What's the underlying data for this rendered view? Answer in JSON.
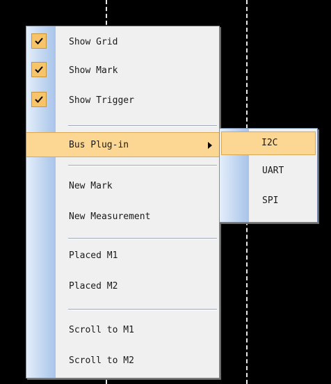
{
  "menu": {
    "items": [
      {
        "label": "Show Grid",
        "checked": true,
        "icon": "check-icon"
      },
      {
        "label": "Show Mark",
        "checked": true,
        "icon": "check-icon"
      },
      {
        "label": "Show Trigger",
        "checked": true,
        "icon": "check-icon"
      },
      {
        "label": "Bus Plug-in",
        "highlighted": true,
        "has_submenu": true,
        "icon": "chevron-right-icon"
      },
      {
        "label": "New Mark"
      },
      {
        "label": "New Measurement"
      },
      {
        "label": "Placed M1"
      },
      {
        "label": "Placed M2"
      },
      {
        "label": "Scroll to M1"
      },
      {
        "label": "Scroll to M2"
      }
    ]
  },
  "submenu": {
    "items": [
      {
        "label": "I2C",
        "highlighted": true
      },
      {
        "label": "UART"
      },
      {
        "label": "SPI"
      }
    ]
  },
  "colors": {
    "background": "#000000",
    "menu_background": "#f0f0f0",
    "highlight": "#fbd793",
    "check_box": "#f7c469",
    "gutter": "#b9d0ee",
    "grid_line": "#e8e8e8"
  }
}
